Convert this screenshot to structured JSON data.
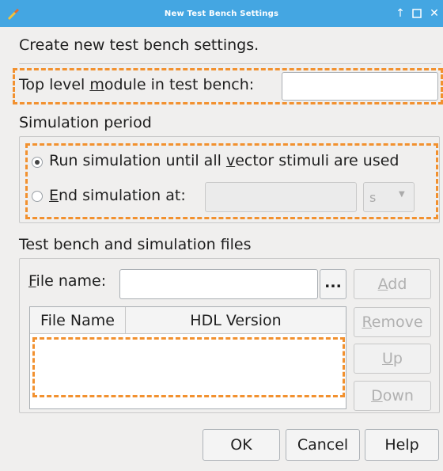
{
  "window": {
    "title": "New Test Bench Settings"
  },
  "heading": "Create new test bench settings.",
  "top_level": {
    "label_pre": "Top level ",
    "label_ul": "m",
    "label_post": "odule in test bench:",
    "value": ""
  },
  "sim_period": {
    "title": "Simulation period",
    "run_pre": "Run simulation until all ",
    "run_ul": "v",
    "run_post": "ector stimuli are used",
    "end_ul": "E",
    "end_post": "nd simulation at:",
    "end_value": "",
    "unit": "s"
  },
  "files": {
    "title": "Test bench and simulation files",
    "file_label_ul": "F",
    "file_label_post": "ile name:",
    "file_value": "",
    "browse": "...",
    "columns": [
      "File Name",
      "HDL Version"
    ],
    "add_ul": "A",
    "add_post": "dd",
    "remove_ul": "R",
    "remove_post": "emove",
    "up_ul": "U",
    "up_post": "p",
    "down_ul": "D",
    "down_post": "own"
  },
  "buttons": {
    "ok": "OK",
    "cancel": "Cancel",
    "help": "Help"
  }
}
